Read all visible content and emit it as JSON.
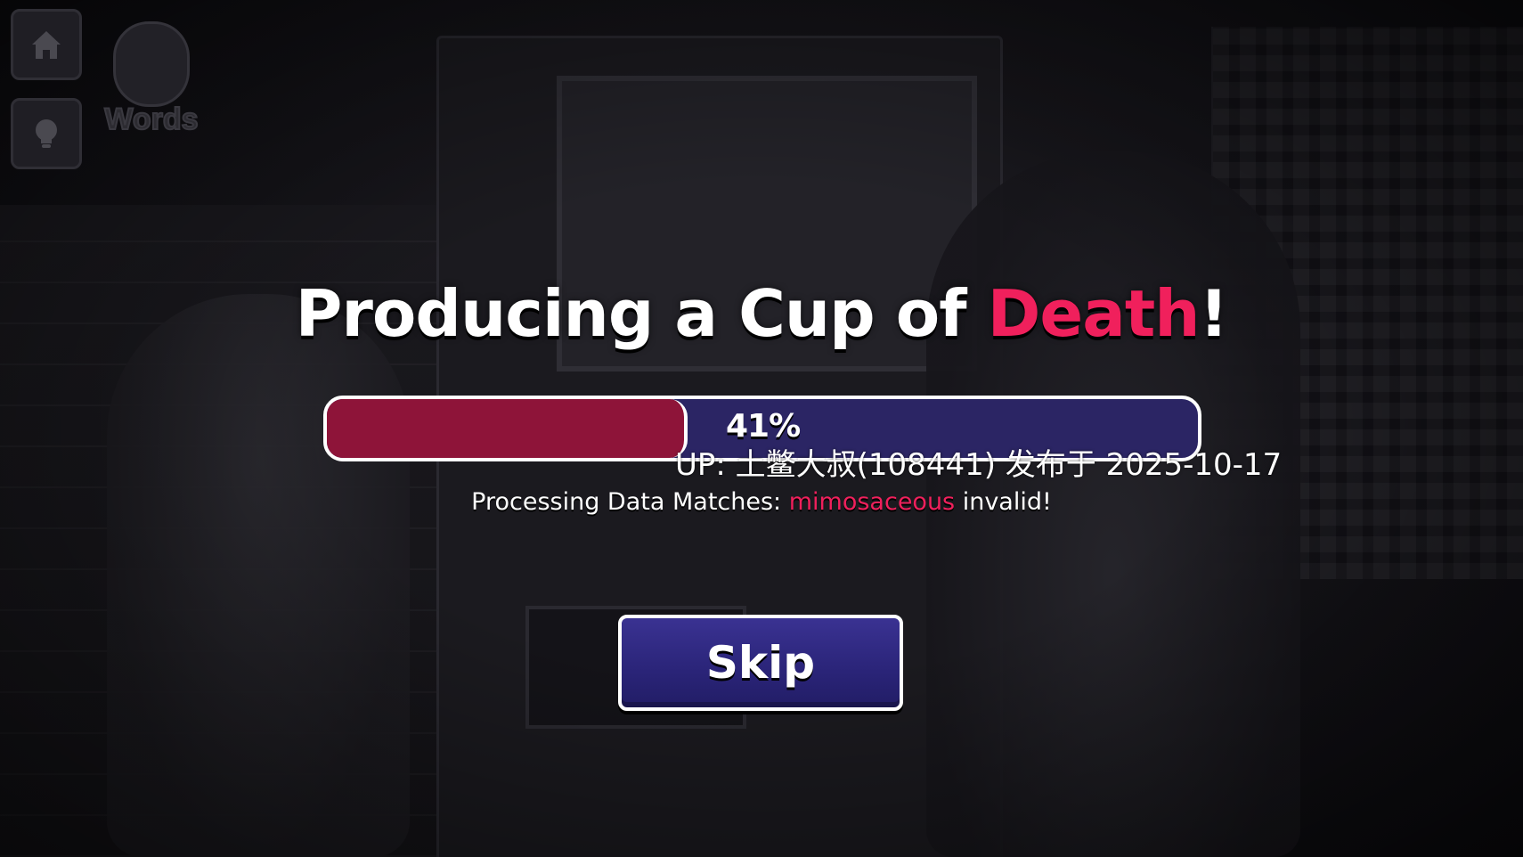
{
  "title": {
    "prefix": "Producing a Cup of ",
    "highlight": "Death",
    "suffix": "!"
  },
  "progress": {
    "value": 0.41,
    "label": "41%"
  },
  "watermark": "UP: 土鳖大叔(108441) 发布于 2025-10-17",
  "status": {
    "prefix": "Processing Data Matches: ",
    "word": "mimosaceous",
    "suffix": " invalid!"
  },
  "skip_label": "Skip",
  "logo_text": "Words",
  "icons": {
    "home": "home-icon",
    "hint": "lightbulb-icon"
  },
  "colors": {
    "accent": "#f0205c",
    "progress_fill": "#8e1439",
    "progress_track": "#2b2564",
    "button": "#2a2478"
  }
}
